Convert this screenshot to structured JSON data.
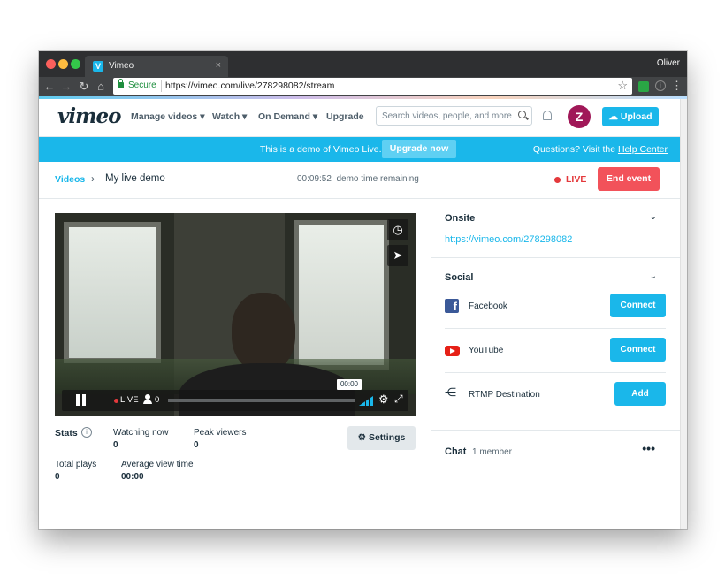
{
  "browser": {
    "tab_title": "Vimeo",
    "tab_icon": "V",
    "tab_close": "×",
    "user_name": "Oliver",
    "secure_label": "Secure",
    "url": "https://vimeo.com/live/278298082/stream"
  },
  "header": {
    "logo": "vimeo",
    "nav": [
      "Manage videos",
      "Watch",
      "On Demand",
      "Upgrade"
    ],
    "search_placeholder": "Search videos, people, and more",
    "avatar_initial": "Z",
    "upload_label": "Upload"
  },
  "banner": {
    "text": "This is a demo of Vimeo Live.",
    "upgrade_label": "Upgrade now",
    "help_prefix": "Questions? Visit the ",
    "help_link": "Help Center",
    "color": "#1ab7ea"
  },
  "livebar": {
    "breadcrumb_root": "Videos",
    "breadcrumb_sep": "›",
    "event_title": "My live demo",
    "timer": "00:09:52  demo time remaining",
    "live_label": "LIVE",
    "end_label": "End event",
    "live_color": "#e4393c"
  },
  "player": {
    "live_label": "LIVE",
    "viewer_count": "0",
    "time": "00:00"
  },
  "stats": {
    "heading": "Stats",
    "watching_label": "Watching now",
    "watching_value": "0",
    "peak_label": "Peak viewers",
    "peak_value": "0",
    "plays_label": "Total plays",
    "plays_value": "0",
    "avg_label": "Average view time",
    "avg_value": "00:00",
    "settings_label": "Settings"
  },
  "panel": {
    "onsite_title": "Onsite",
    "onsite_link": "https://vimeo.com/278298082",
    "social_title": "Social",
    "destinations": [
      {
        "name": "Facebook",
        "action": "Connect"
      },
      {
        "name": "YouTube",
        "action": "Connect"
      },
      {
        "name": "RTMP Destination",
        "action": "Add"
      }
    ],
    "chat_title": "Chat",
    "chat_members": "1 member",
    "chat_more": "•••"
  }
}
